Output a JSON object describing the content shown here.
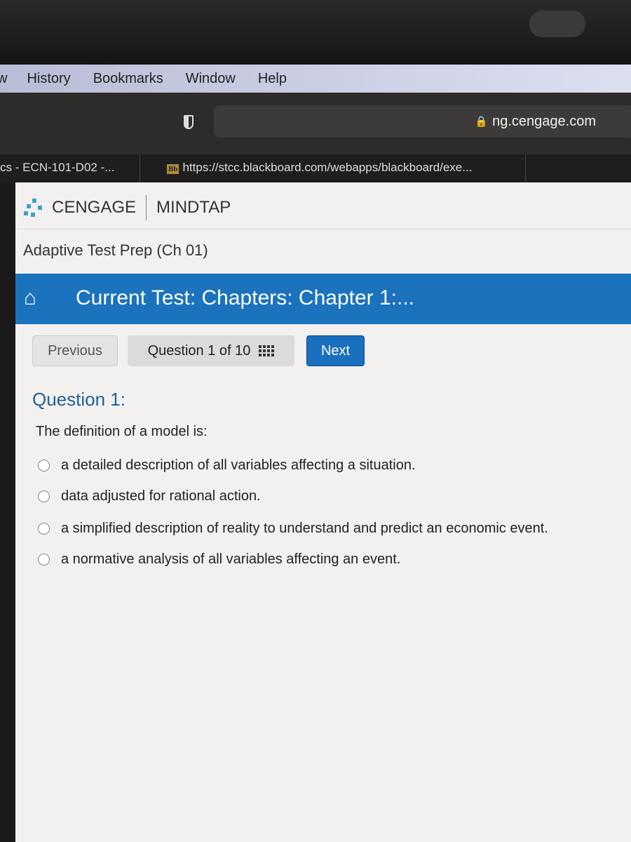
{
  "menubar": {
    "items": [
      "History",
      "Bookmarks",
      "Window",
      "Help"
    ]
  },
  "toolbar": {
    "url": "ng.cengage.com"
  },
  "tabs": [
    {
      "label": "cs - ECN-101-D02 -..."
    },
    {
      "label": "https://stcc.blackboard.com/webapps/blackboard/exe...",
      "favicon": "Bb"
    }
  ],
  "brand": {
    "name": "CENGAGE",
    "product": "MINDTAP"
  },
  "page": {
    "title": "Adaptive Test Prep (Ch 01)",
    "current_test": "Current Test: Chapters: Chapter 1:..."
  },
  "nav": {
    "previous": "Previous",
    "question_selector": "Question 1 of 10",
    "next": "Next"
  },
  "question": {
    "heading": "Question 1:",
    "text": "The definition of a model is:",
    "options": [
      "a detailed description of all variables affecting a situation.",
      "data adjusted for rational action.",
      "a simplified description of reality to understand and predict an economic event.",
      "a normative analysis of all variables affecting an event."
    ]
  },
  "colors": {
    "accent": "#1a73bc",
    "heading": "#1f5f96"
  }
}
